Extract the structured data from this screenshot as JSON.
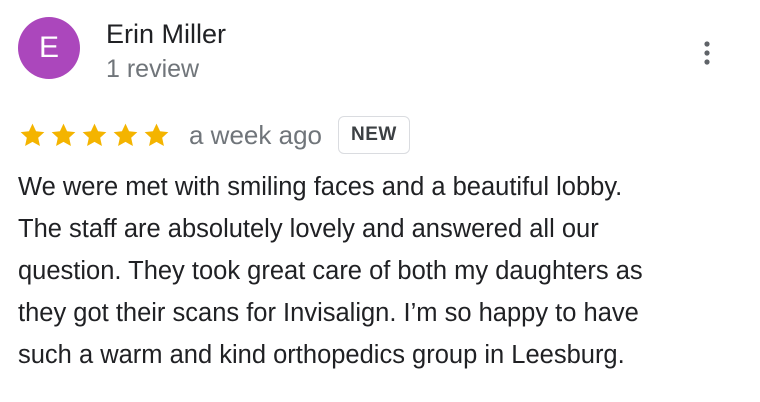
{
  "reviewer": {
    "initial": "E",
    "name": "Erin Miller",
    "review_count": "1 review",
    "avatar_color": "#ab47bc"
  },
  "actions": {
    "more_icon": "more-vert-icon"
  },
  "review": {
    "rating": 5,
    "max_rating": 5,
    "star_icon": "star-icon",
    "star_color": "#f4b400",
    "time": "a week ago",
    "badge": "NEW",
    "text_lines": [
      "We were met with smiling faces and a beautiful lobby.",
      "The staff are absolutely lovely and answered all our",
      "question. They took great care of both my daughters as",
      "they got their scans for Invisalign. I’m so happy to have",
      "such a warm and kind orthopedics group in Leesburg."
    ]
  }
}
